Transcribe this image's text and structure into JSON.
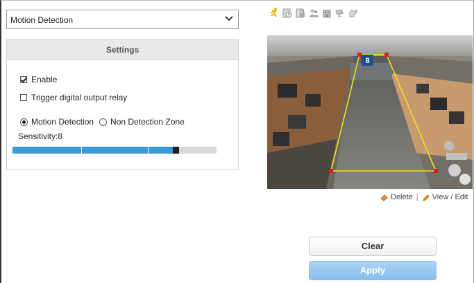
{
  "mode_select": {
    "value": "Motion Detection"
  },
  "settings": {
    "title": "Settings",
    "enable_label": "Enable",
    "enable_checked": true,
    "relay_label": "Trigger digital output relay",
    "relay_checked": false,
    "radio_motion_label": "Motion Detection",
    "radio_non_label": "Non Detection Zone",
    "selected_zone_mode": "Motion Detection",
    "sensitivity_label": "Sensitivity:8",
    "sensitivity_value": 8,
    "sensitivity_max": 10
  },
  "toolbar": {
    "icons": [
      "running-person-icon",
      "clock-icon",
      "lock-icon",
      "people-icon",
      "building-icon",
      "camera-icon",
      "hand-icon"
    ]
  },
  "video": {
    "zone_number": "8"
  },
  "links": {
    "delete": "Delete",
    "separator": "|",
    "view_edit": "View / Edit"
  },
  "buttons": {
    "clear": "Clear",
    "apply": "Apply"
  },
  "colors": {
    "accent": "#3a9ad1",
    "zone_outline": "#f2e21a",
    "apply_button": "#88bfed"
  }
}
